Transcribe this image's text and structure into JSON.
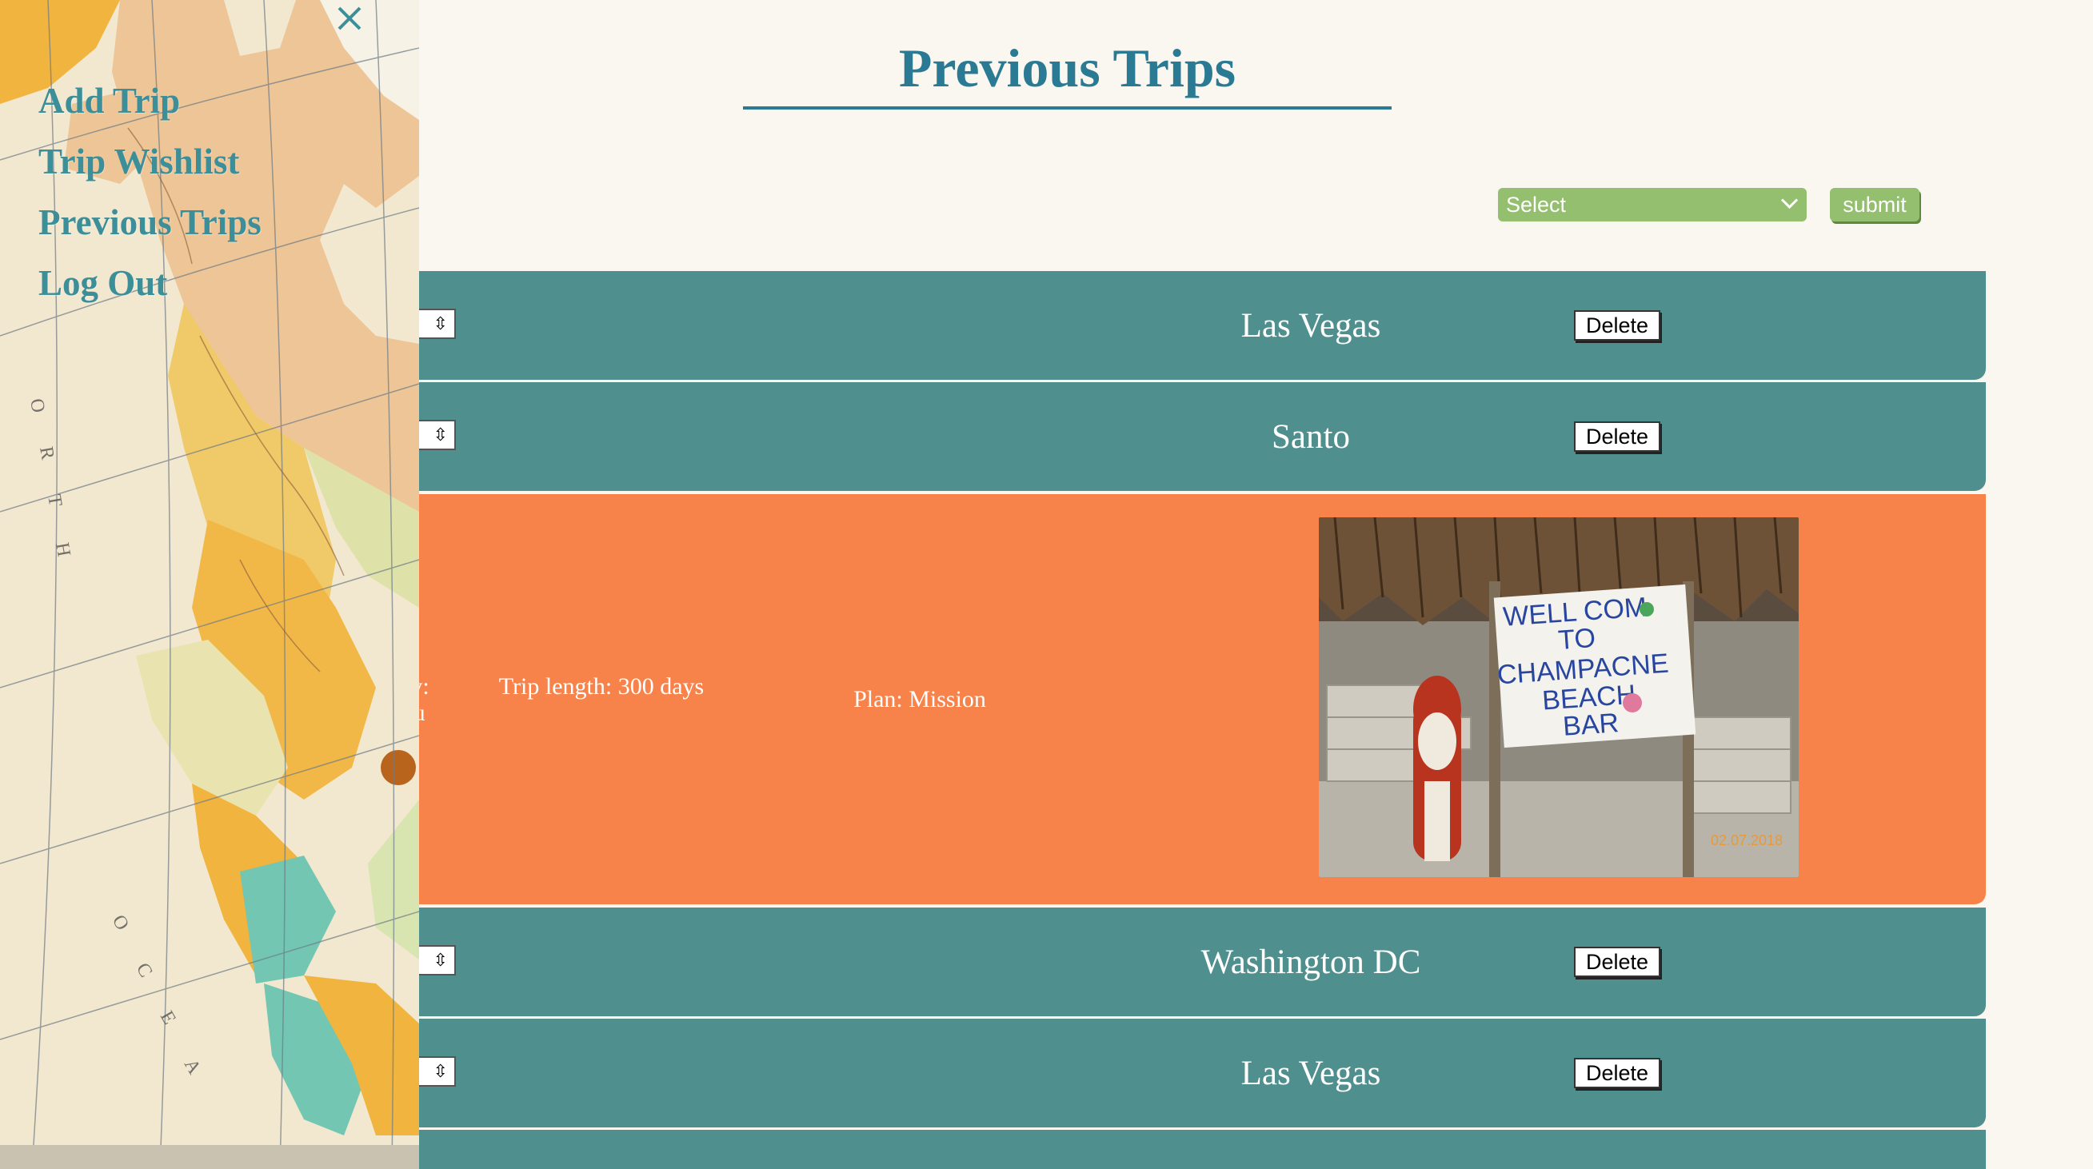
{
  "page": {
    "title": "Previous Trips"
  },
  "filter": {
    "selected": "Select",
    "submit_label": "submit"
  },
  "colors": {
    "accent": "#2a7a94",
    "row_bg": "#4f8f8e",
    "expanded_bg": "#f8834a",
    "button_green": "#93bf6e",
    "nav_link": "#3c8e98"
  },
  "sidebar": {
    "close_icon": "close-icon",
    "items": [
      {
        "label": "Add Trip"
      },
      {
        "label": "Trip Wishlist"
      },
      {
        "label": "Previous Trips"
      },
      {
        "label": "Log Out"
      }
    ]
  },
  "trips": [
    {
      "name": "Las Vegas",
      "toggle_icon": "⇳",
      "delete_label": "Delete"
    },
    {
      "name": "Santo",
      "toggle_icon": "⇳",
      "delete_label": "Delete"
    },
    {
      "name": "Washington DC",
      "toggle_icon": "⇳",
      "delete_label": "Delete"
    },
    {
      "name": "Las Vegas",
      "toggle_icon": "⇳",
      "delete_label": "Delete"
    }
  ],
  "expanded_trip": {
    "country_partial": "ntry:",
    "country_value_partial": "uatu",
    "trip_length": "Trip length: 300 days",
    "plan": "Plan: Mission",
    "photo_sign_text": [
      "WELL COM",
      "TO",
      "CHAMPACNE",
      "BEACH",
      "BAR"
    ],
    "photo_date": "02.07.2018"
  }
}
